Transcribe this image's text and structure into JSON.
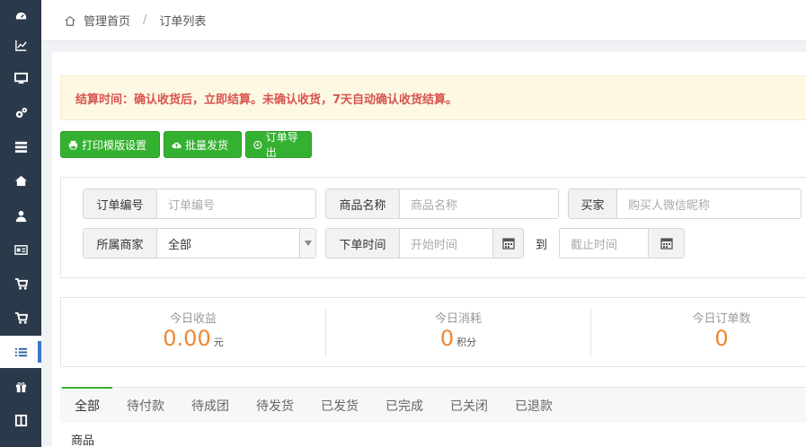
{
  "sidebar": {
    "icons": [
      "dashboard-icon",
      "chart-icon",
      "monitor-icon",
      "settings-icon",
      "list-icon",
      "home-icon",
      "user-icon",
      "card-icon",
      "cart-icon",
      "cart-icon",
      "order-list-icon",
      "gift-icon",
      "grid-icon"
    ],
    "active_index": 10
  },
  "breadcrumb": {
    "home": "管理首页",
    "separator": "/",
    "current": "订单列表"
  },
  "alert": {
    "text": "结算时间：确认收货后，立即结算。未确认收货，7天自动确认收货结算。"
  },
  "toolbar": {
    "print_label": "打印模版设置",
    "batch_ship_label": "批量发货",
    "export_label": "订单导出"
  },
  "filters": {
    "order_no": {
      "label": "订单编号",
      "placeholder": "订单编号"
    },
    "product_name": {
      "label": "商品名称",
      "placeholder": "商品名称"
    },
    "buyer": {
      "label": "买家",
      "placeholder": "购买人微信昵称"
    },
    "merchant": {
      "label": "所属商家",
      "value": "全部"
    },
    "order_time": {
      "label": "下单时间",
      "start_placeholder": "开始时间",
      "to": "到",
      "end_placeholder": "截止时间"
    }
  },
  "stats": {
    "income": {
      "label": "今日收益",
      "value": "0.00",
      "unit": "元"
    },
    "consumption": {
      "label": "今日消耗",
      "value": "0",
      "unit": "积分"
    },
    "orders": {
      "label": "今日订单数",
      "value": "0"
    }
  },
  "tabs": [
    "全部",
    "待付款",
    "待成团",
    "待发货",
    "已发货",
    "已完成",
    "已关闭",
    "已退款"
  ],
  "table": {
    "col_product": "商品"
  },
  "colors": {
    "sidebar": "#2b3a4a",
    "green": "#35b131",
    "orange": "#f0862f",
    "alert_text": "#d9534f"
  }
}
